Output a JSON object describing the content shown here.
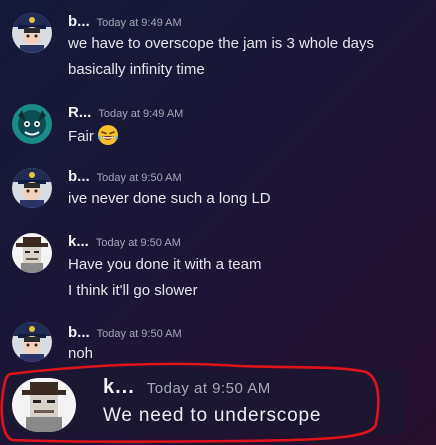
{
  "messages": [
    {
      "author": "b...",
      "time": "Today at 9:49 AM",
      "lines": [
        "we have to overscope the jam is 3 whole days",
        "basically infinity time"
      ],
      "avatar": "police-avatar"
    },
    {
      "author": "R...",
      "time": "Today at 9:49 AM",
      "lines": [
        "Fair"
      ],
      "emoji": "laughing-tears-emoji",
      "avatar": "teal-creature-avatar"
    },
    {
      "author": "b...",
      "time": "Today at 9:50 AM",
      "lines": [
        "ive never done such a long LD"
      ],
      "avatar": "police-avatar"
    },
    {
      "author": "k...",
      "time": "Today at 9:50 AM",
      "lines": [
        "Have you done it with a team",
        "I think it'll go slower"
      ],
      "avatar": "cowboy-avatar"
    },
    {
      "author": "b...",
      "time": "Today at 9:50 AM",
      "lines": [
        "noh"
      ],
      "avatar": "police-avatar"
    }
  ],
  "highlighted_message": {
    "author": "k...",
    "time": "Today at 9:50 AM",
    "text": "We need to underscope",
    "avatar": "cowboy-avatar"
  },
  "colors": {
    "highlight_outline": "#e0131b",
    "username": "#f2f3f5",
    "timestamp": "#a4a8b4"
  }
}
